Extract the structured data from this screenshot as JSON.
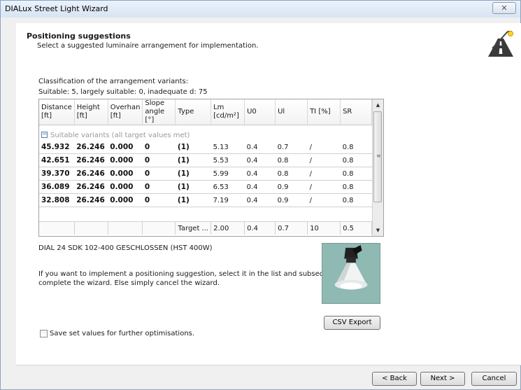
{
  "window": {
    "title": "DIALux Street Light Wizard",
    "close_glyph": "✕"
  },
  "header": {
    "title": "Positioning suggestions",
    "subtitle": "Select a suggested luminaire arrangement for implementation.",
    "icon": "road-icon"
  },
  "classification": {
    "label": "Classification of the arrangement variants:",
    "summary": "Suitable: 5, largely suitable: 0, inadequate d: 75"
  },
  "table": {
    "headers": [
      "Distance [ft]",
      "Height [ft]",
      "Overhan [ft]",
      "Slope angle [°]",
      "Type",
      "Lm [cd/m²]",
      "U0",
      "Ul",
      "TI [%]",
      "SR"
    ],
    "group_label": "Suitable variants (all target values met)",
    "rows": [
      [
        "45.932",
        "26.246",
        "0.000",
        "0",
        "(1)",
        "5.13",
        "0.4",
        "0.7",
        "/",
        "0.8"
      ],
      [
        "42.651",
        "26.246",
        "0.000",
        "0",
        "(1)",
        "5.53",
        "0.4",
        "0.8",
        "/",
        "0.8"
      ],
      [
        "39.370",
        "26.246",
        "0.000",
        "0",
        "(1)",
        "5.99",
        "0.4",
        "0.8",
        "/",
        "0.8"
      ],
      [
        "36.089",
        "26.246",
        "0.000",
        "0",
        "(1)",
        "6.53",
        "0.4",
        "0.9",
        "/",
        "0.8"
      ],
      [
        "32.808",
        "26.246",
        "0.000",
        "0",
        "(1)",
        "7.19",
        "0.4",
        "0.9",
        "/",
        "0.8"
      ]
    ],
    "target_row": [
      "",
      "",
      "",
      "",
      "Target ...",
      "2.00",
      "0.4",
      "0.7",
      "10",
      "0.5"
    ]
  },
  "luminaire": {
    "name": "DIAL 24 SDK 102-400 GESCHLOSSEN (HST 400W)"
  },
  "info": {
    "line1": "If you want to implement a positioning suggestion, select it in the list and subsequently",
    "line2": "complete the wizard. Else simply cancel the wizard."
  },
  "buttons": {
    "csv_export": "CSV Export",
    "back": "< Back",
    "next": "Next >",
    "cancel": "Cancel"
  },
  "checkbox": {
    "label": "Save set values for further optimisations.",
    "checked": false
  }
}
